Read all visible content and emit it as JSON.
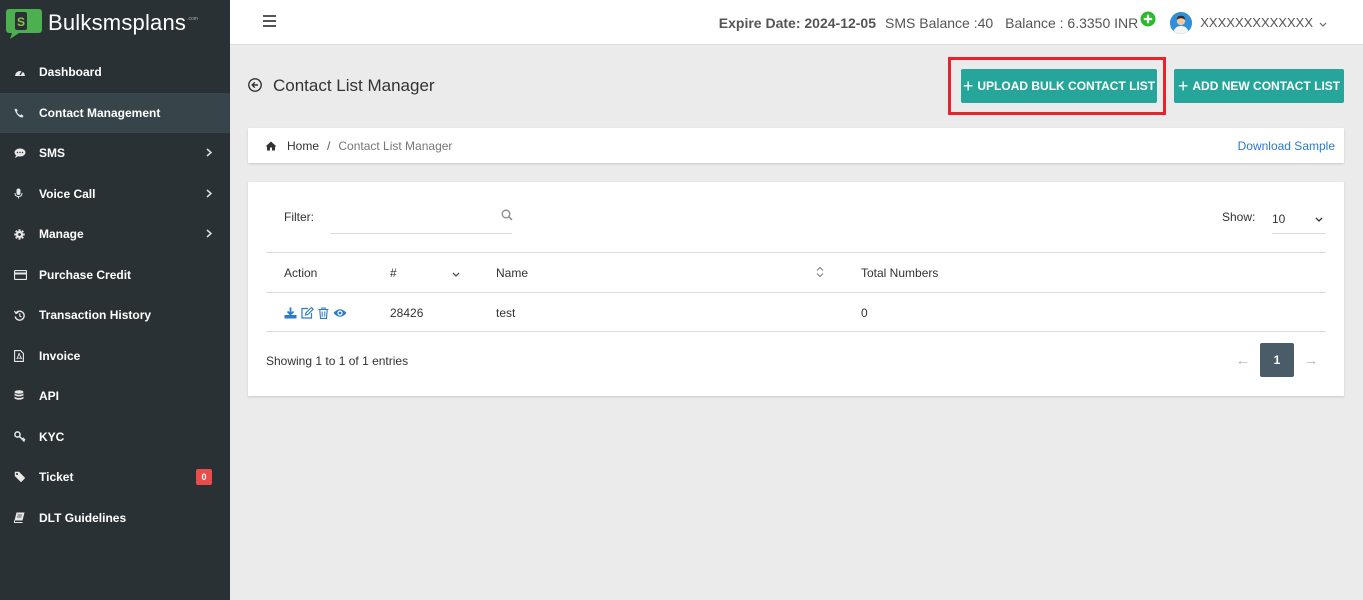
{
  "brand": {
    "name": "Bulksmsplans",
    "suffix": ".com"
  },
  "sidebar": {
    "items": [
      {
        "label": "Dashboard",
        "icon": "dashboard-icon"
      },
      {
        "label": "Contact Management",
        "icon": "phone-icon"
      },
      {
        "label": "SMS",
        "icon": "chat-icon"
      },
      {
        "label": "Voice Call",
        "icon": "microphone-icon"
      },
      {
        "label": "Manage",
        "icon": "gear-icon"
      },
      {
        "label": "Purchase Credit",
        "icon": "credit-card-icon"
      },
      {
        "label": "Transaction History",
        "icon": "history-icon"
      },
      {
        "label": "Invoice",
        "icon": "invoice-icon"
      },
      {
        "label": "API",
        "icon": "database-icon"
      },
      {
        "label": "KYC",
        "icon": "key-icon"
      },
      {
        "label": "Ticket",
        "icon": "ticket-icon",
        "badge": "0"
      },
      {
        "label": "DLT Guidelines",
        "icon": "book-icon"
      }
    ]
  },
  "topbar": {
    "expire": "Expire Date: 2024-12-05",
    "sms_balance": "SMS Balance :40",
    "balance": "Balance : 6.3350 INR",
    "username": "XXXXXXXXXXXXX"
  },
  "page": {
    "title": "Contact List Manager",
    "upload_button": "UPLOAD BULK CONTACT LIST",
    "add_button": "ADD NEW CONTACT LIST"
  },
  "breadcrumb": {
    "home": "Home",
    "separator": "/",
    "current": "Contact List Manager",
    "download": "Download Sample"
  },
  "table": {
    "filter_label": "Filter:",
    "filter_value": "",
    "show_label": "Show:",
    "show_value": "10",
    "headers": {
      "action": "Action",
      "number": "#",
      "name": "Name",
      "total": "Total Numbers"
    },
    "rows": [
      {
        "id": "28426",
        "name": "test",
        "total": "0"
      }
    ],
    "entries": "Showing 1 to 1 of 1 entries",
    "pagination": {
      "prev": "←",
      "page": "1",
      "next": "→"
    }
  },
  "colors": {
    "sidebar": "#2a3135",
    "accent": "#26a69a",
    "highlight": "#e8232b",
    "link": "#2a7bcc",
    "badge": "#e84c4c"
  }
}
